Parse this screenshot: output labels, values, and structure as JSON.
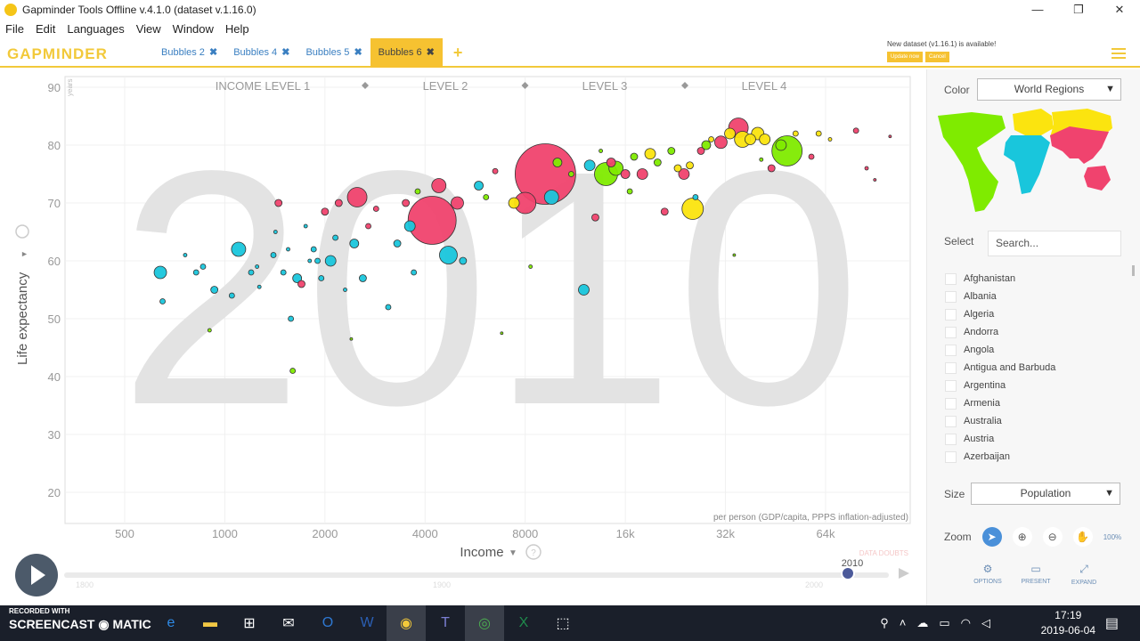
{
  "window": {
    "title": "Gapminder Tools Offline v.4.1.0 (dataset v.1.16.0)",
    "controls": [
      "—",
      "❐",
      "✕"
    ]
  },
  "menu": [
    "File",
    "Edit",
    "Languages",
    "View",
    "Window",
    "Help"
  ],
  "logo": "GAPMINDER",
  "tabs": [
    {
      "label": "Bubbles 2",
      "close": "✖"
    },
    {
      "label": "Bubbles 4",
      "close": "✖"
    },
    {
      "label": "Bubbles 5",
      "close": "✖"
    },
    {
      "label": "Bubbles 6",
      "close": "✖"
    }
  ],
  "add_tab": "+",
  "update_notice": {
    "text": "New dataset (v1.16.1) is available!",
    "update_btn": "Update now",
    "cancel_btn": "Cancel"
  },
  "chart_data": {
    "type": "scatter",
    "year": "2010",
    "income_levels": [
      "INCOME LEVEL 1",
      "LEVEL 2",
      "LEVEL 3",
      "LEVEL 4"
    ],
    "ylabel": "Life expectancy",
    "yunit": "years",
    "y_ticks": [
      20,
      30,
      40,
      50,
      60,
      70,
      80,
      90
    ],
    "xlabel": "Income",
    "x_ticks": [
      "500",
      "1000",
      "2000",
      "4000",
      "8000",
      "16k",
      "32k",
      "64k"
    ],
    "x_scale": "log",
    "x_note": "per person (GDP/capita, PPPS inflation-adjusted)",
    "data_doubts": "DATA DOUBTS",
    "timeline": {
      "start": "1800",
      "mid": "1900",
      "end": "2000",
      "current": "2010"
    },
    "colors": {
      "asia": "#f0436e",
      "africa": "#19c6dc",
      "europe": "#fbe40f",
      "americas": "#7feb00"
    },
    "bubbles": [
      {
        "x": 640,
        "y": 58,
        "r": 7,
        "c": "africa"
      },
      {
        "x": 650,
        "y": 53,
        "r": 3,
        "c": "africa"
      },
      {
        "x": 760,
        "y": 61,
        "r": 2,
        "c": "africa"
      },
      {
        "x": 820,
        "y": 58,
        "r": 3,
        "c": "africa"
      },
      {
        "x": 860,
        "y": 59,
        "r": 3,
        "c": "africa"
      },
      {
        "x": 900,
        "y": 48,
        "r": 2,
        "c": "americas"
      },
      {
        "x": 930,
        "y": 55,
        "r": 4,
        "c": "africa"
      },
      {
        "x": 1050,
        "y": 54,
        "r": 3,
        "c": "africa"
      },
      {
        "x": 1100,
        "y": 62,
        "r": 8,
        "c": "africa"
      },
      {
        "x": 1200,
        "y": 58,
        "r": 3,
        "c": "africa"
      },
      {
        "x": 1250,
        "y": 59,
        "r": 2,
        "c": "africa"
      },
      {
        "x": 1270,
        "y": 55.5,
        "r": 2,
        "c": "africa"
      },
      {
        "x": 1400,
        "y": 61,
        "r": 3,
        "c": "africa"
      },
      {
        "x": 1420,
        "y": 65,
        "r": 2,
        "c": "africa"
      },
      {
        "x": 1450,
        "y": 70,
        "r": 4,
        "c": "asia"
      },
      {
        "x": 1500,
        "y": 58,
        "r": 3,
        "c": "africa"
      },
      {
        "x": 1550,
        "y": 62,
        "r": 2,
        "c": "africa"
      },
      {
        "x": 1580,
        "y": 50,
        "r": 3,
        "c": "africa"
      },
      {
        "x": 1600,
        "y": 41,
        "r": 3,
        "c": "americas"
      },
      {
        "x": 1650,
        "y": 57,
        "r": 5,
        "c": "africa"
      },
      {
        "x": 1700,
        "y": 56,
        "r": 4,
        "c": "asia"
      },
      {
        "x": 1750,
        "y": 66,
        "r": 2,
        "c": "africa"
      },
      {
        "x": 1800,
        "y": 60,
        "r": 2,
        "c": "africa"
      },
      {
        "x": 1850,
        "y": 62,
        "r": 3,
        "c": "africa"
      },
      {
        "x": 1900,
        "y": 60,
        "r": 3,
        "c": "africa"
      },
      {
        "x": 1950,
        "y": 57,
        "r": 3,
        "c": "africa"
      },
      {
        "x": 2000,
        "y": 68.5,
        "r": 4,
        "c": "asia"
      },
      {
        "x": 2080,
        "y": 60,
        "r": 6,
        "c": "africa"
      },
      {
        "x": 2150,
        "y": 64,
        "r": 3,
        "c": "africa"
      },
      {
        "x": 2200,
        "y": 70,
        "r": 4,
        "c": "asia"
      },
      {
        "x": 2300,
        "y": 55,
        "r": 2,
        "c": "africa"
      },
      {
        "x": 2400,
        "y": 46.5,
        "r": 1.5,
        "c": "americas"
      },
      {
        "x": 2450,
        "y": 63,
        "r": 5,
        "c": "africa"
      },
      {
        "x": 2500,
        "y": 71,
        "r": 11,
        "c": "asia"
      },
      {
        "x": 2600,
        "y": 57,
        "r": 4,
        "c": "africa"
      },
      {
        "x": 2700,
        "y": 66,
        "r": 3,
        "c": "asia"
      },
      {
        "x": 2850,
        "y": 69,
        "r": 3,
        "c": "asia"
      },
      {
        "x": 3100,
        "y": 52,
        "r": 3,
        "c": "africa"
      },
      {
        "x": 3300,
        "y": 63,
        "r": 4,
        "c": "africa"
      },
      {
        "x": 3500,
        "y": 70,
        "r": 4,
        "c": "asia"
      },
      {
        "x": 3600,
        "y": 66,
        "r": 6,
        "c": "africa"
      },
      {
        "x": 3700,
        "y": 58,
        "r": 3,
        "c": "africa"
      },
      {
        "x": 3800,
        "y": 72,
        "r": 3,
        "c": "americas"
      },
      {
        "x": 4200,
        "y": 67,
        "r": 27,
        "c": "asia"
      },
      {
        "x": 4400,
        "y": 73,
        "r": 8,
        "c": "asia"
      },
      {
        "x": 4700,
        "y": 61,
        "r": 10,
        "c": "africa"
      },
      {
        "x": 5000,
        "y": 70,
        "r": 7,
        "c": "asia"
      },
      {
        "x": 5200,
        "y": 60,
        "r": 4,
        "c": "africa"
      },
      {
        "x": 5800,
        "y": 73,
        "r": 5,
        "c": "africa"
      },
      {
        "x": 6100,
        "y": 71,
        "r": 3,
        "c": "americas"
      },
      {
        "x": 6500,
        "y": 75.5,
        "r": 3,
        "c": "asia"
      },
      {
        "x": 6800,
        "y": 47.5,
        "r": 1.5,
        "c": "americas"
      },
      {
        "x": 7400,
        "y": 70,
        "r": 6,
        "c": "europe"
      },
      {
        "x": 8000,
        "y": 70,
        "r": 12,
        "c": "asia"
      },
      {
        "x": 8300,
        "y": 59,
        "r": 2,
        "c": "americas"
      },
      {
        "x": 9200,
        "y": 75,
        "r": 34,
        "c": "asia"
      },
      {
        "x": 9600,
        "y": 71,
        "r": 8,
        "c": "africa"
      },
      {
        "x": 10000,
        "y": 77,
        "r": 5,
        "c": "americas"
      },
      {
        "x": 11000,
        "y": 75,
        "r": 3,
        "c": "americas"
      },
      {
        "x": 12000,
        "y": 55,
        "r": 6,
        "c": "africa"
      },
      {
        "x": 12500,
        "y": 76.5,
        "r": 6,
        "c": "africa"
      },
      {
        "x": 13000,
        "y": 67.5,
        "r": 4,
        "c": "asia"
      },
      {
        "x": 13500,
        "y": 79,
        "r": 2,
        "c": "americas"
      },
      {
        "x": 14000,
        "y": 75,
        "r": 13,
        "c": "americas"
      },
      {
        "x": 14500,
        "y": 77,
        "r": 5,
        "c": "asia"
      },
      {
        "x": 15000,
        "y": 76,
        "r": 8,
        "c": "americas"
      },
      {
        "x": 16000,
        "y": 75,
        "r": 5,
        "c": "asia"
      },
      {
        "x": 16500,
        "y": 72,
        "r": 3,
        "c": "americas"
      },
      {
        "x": 17000,
        "y": 78,
        "r": 4,
        "c": "americas"
      },
      {
        "x": 18000,
        "y": 75,
        "r": 6,
        "c": "asia"
      },
      {
        "x": 19000,
        "y": 78.5,
        "r": 6,
        "c": "europe"
      },
      {
        "x": 20000,
        "y": 77,
        "r": 4,
        "c": "americas"
      },
      {
        "x": 21000,
        "y": 68.5,
        "r": 4,
        "c": "asia"
      },
      {
        "x": 22000,
        "y": 79,
        "r": 4,
        "c": "americas"
      },
      {
        "x": 23000,
        "y": 76,
        "r": 4,
        "c": "europe"
      },
      {
        "x": 24000,
        "y": 75,
        "r": 6,
        "c": "asia"
      },
      {
        "x": 25000,
        "y": 76.5,
        "r": 4,
        "c": "europe"
      },
      {
        "x": 25500,
        "y": 69,
        "r": 12,
        "c": "europe"
      },
      {
        "x": 26000,
        "y": 71,
        "r": 3,
        "c": "africa"
      },
      {
        "x": 27000,
        "y": 79,
        "r": 4,
        "c": "asia"
      },
      {
        "x": 28000,
        "y": 80,
        "r": 5,
        "c": "americas"
      },
      {
        "x": 29000,
        "y": 81,
        "r": 3,
        "c": "europe"
      },
      {
        "x": 31000,
        "y": 80.5,
        "r": 7,
        "c": "asia"
      },
      {
        "x": 33000,
        "y": 82,
        "r": 6,
        "c": "europe"
      },
      {
        "x": 34000,
        "y": 61,
        "r": 1.5,
        "c": "americas"
      },
      {
        "x": 35000,
        "y": 83,
        "r": 11,
        "c": "asia"
      },
      {
        "x": 36000,
        "y": 81,
        "r": 9,
        "c": "europe"
      },
      {
        "x": 38000,
        "y": 81,
        "r": 6,
        "c": "europe"
      },
      {
        "x": 40000,
        "y": 82,
        "r": 7,
        "c": "europe"
      },
      {
        "x": 41000,
        "y": 77.5,
        "r": 2,
        "c": "americas"
      },
      {
        "x": 42000,
        "y": 81,
        "r": 6,
        "c": "europe"
      },
      {
        "x": 44000,
        "y": 76,
        "r": 4,
        "c": "asia"
      },
      {
        "x": 47000,
        "y": 80,
        "r": 6,
        "c": "americas"
      },
      {
        "x": 49000,
        "y": 79,
        "r": 17,
        "c": "americas"
      },
      {
        "x": 52000,
        "y": 82,
        "r": 3,
        "c": "europe"
      },
      {
        "x": 58000,
        "y": 78,
        "r": 3,
        "c": "asia"
      },
      {
        "x": 61000,
        "y": 82,
        "r": 3,
        "c": "europe"
      },
      {
        "x": 66000,
        "y": 81,
        "r": 2,
        "c": "europe"
      },
      {
        "x": 79000,
        "y": 82.5,
        "r": 3,
        "c": "asia"
      },
      {
        "x": 85000,
        "y": 76,
        "r": 2,
        "c": "asia"
      },
      {
        "x": 90000,
        "y": 74,
        "r": 1.5,
        "c": "asia"
      },
      {
        "x": 100000,
        "y": 81.5,
        "r": 1.5,
        "c": "asia"
      }
    ]
  },
  "panel": {
    "color_label": "Color",
    "color_value": "World Regions",
    "select_label": "Select",
    "search_placeholder": "Search...",
    "countries": [
      "Afghanistan",
      "Albania",
      "Algeria",
      "Andorra",
      "Angola",
      "Antigua and Barbuda",
      "Argentina",
      "Armenia",
      "Australia",
      "Austria",
      "Azerbaijan"
    ],
    "size_label": "Size",
    "size_value": "Population",
    "zoom_label": "Zoom",
    "zoom_level": "100%",
    "buttons": [
      "OPTIONS",
      "PRESENT",
      "EXPAND"
    ]
  },
  "taskbar": {
    "recorded_with": "RECORDED WITH",
    "screencast": "SCREENCAST",
    "matic": "MATIC",
    "time": "17:19",
    "date": "2019-06-04"
  }
}
